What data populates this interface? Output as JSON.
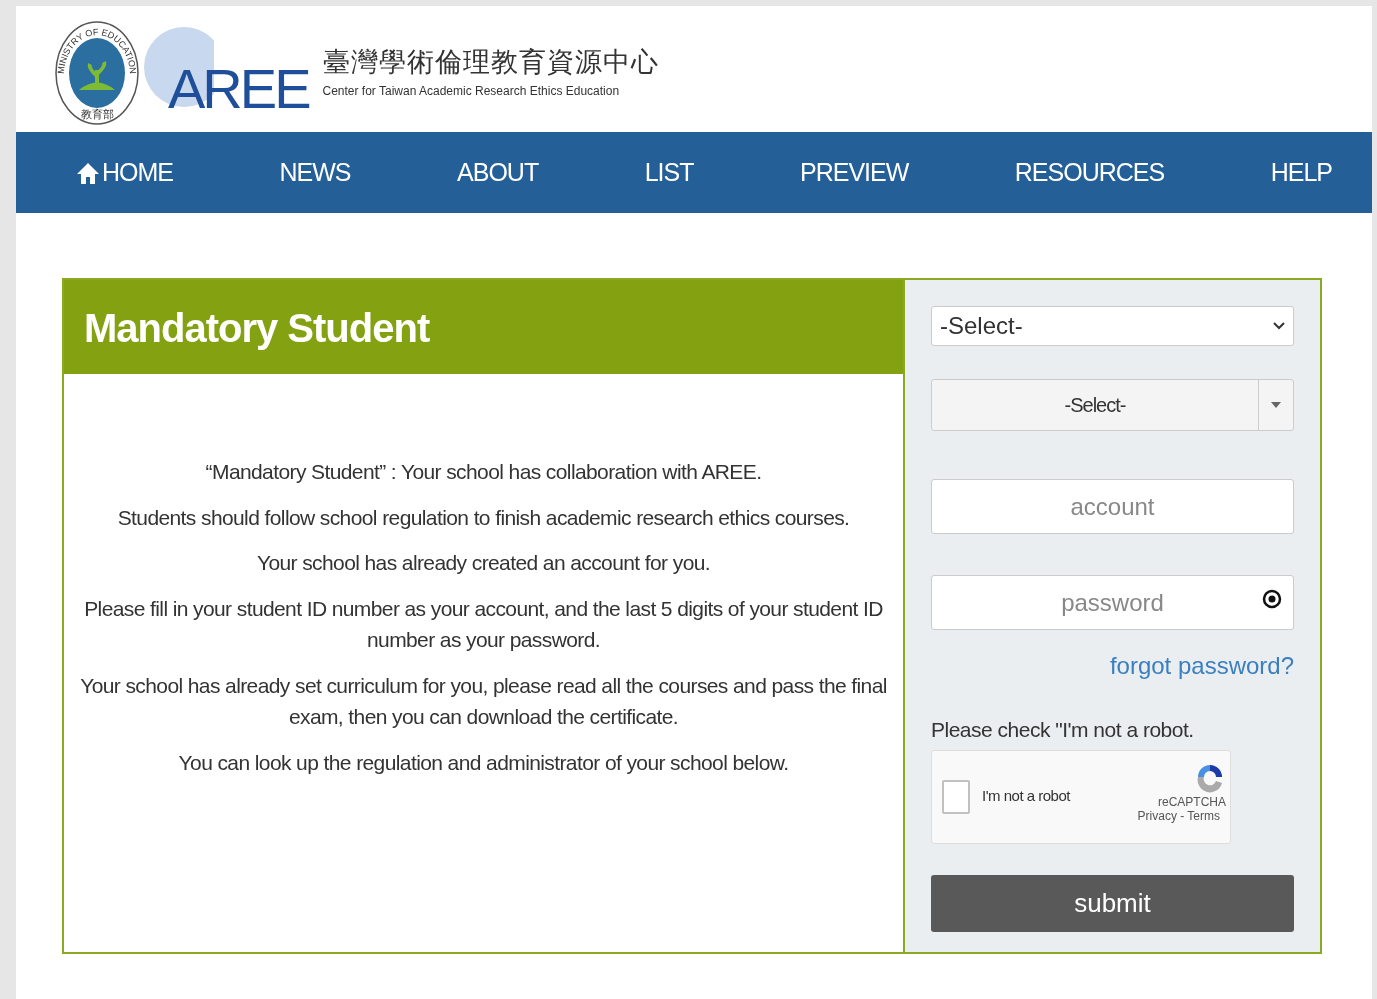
{
  "header": {
    "seal_text": "MINISTRY OF EDUCATION",
    "seal_chinese": "教育部",
    "logo_text": "AREE",
    "title_chinese": "臺灣學術倫理教育資源中心",
    "subtitle": "Center for Taiwan Academic Research Ethics Education"
  },
  "nav": [
    {
      "label": "HOME",
      "kind": "home"
    },
    {
      "label": "NEWS",
      "kind": "plain"
    },
    {
      "label": "ABOUT",
      "kind": "plain"
    },
    {
      "label": "LIST",
      "kind": "plain"
    },
    {
      "label": "PREVIEW",
      "kind": "plain"
    },
    {
      "label": "RESOURCES",
      "kind": "plain"
    },
    {
      "label": "HELP",
      "kind": "plain"
    }
  ],
  "panel": {
    "title": "Mandatory Student",
    "paragraphs": [
      "“Mandatory Student” : Your school has collaboration with AREE.",
      "Students should follow school regulation to finish academic research ethics courses.",
      "Your school has already created an account for you.",
      "Please fill in your student ID number as your account, and the last 5 digits of your student ID number as your password.",
      "Your school has already set curriculum for you, please read all the courses and pass the final exam, then you can download the certificate.",
      "You can look up the regulation and administrator of your school below."
    ]
  },
  "form": {
    "select_1": "-Select-",
    "select_2": "-Select-",
    "account": {
      "placeholder": "account"
    },
    "password": {
      "placeholder": "password"
    },
    "forgot": "forgot password?",
    "captcha_prompt": "Please check \"I'm not a robot.",
    "captcha": {
      "label": "I'm not a robot",
      "checked": false,
      "brand": "reCAPTCHA",
      "links": "Privacy - Terms"
    },
    "submit": "submit"
  }
}
